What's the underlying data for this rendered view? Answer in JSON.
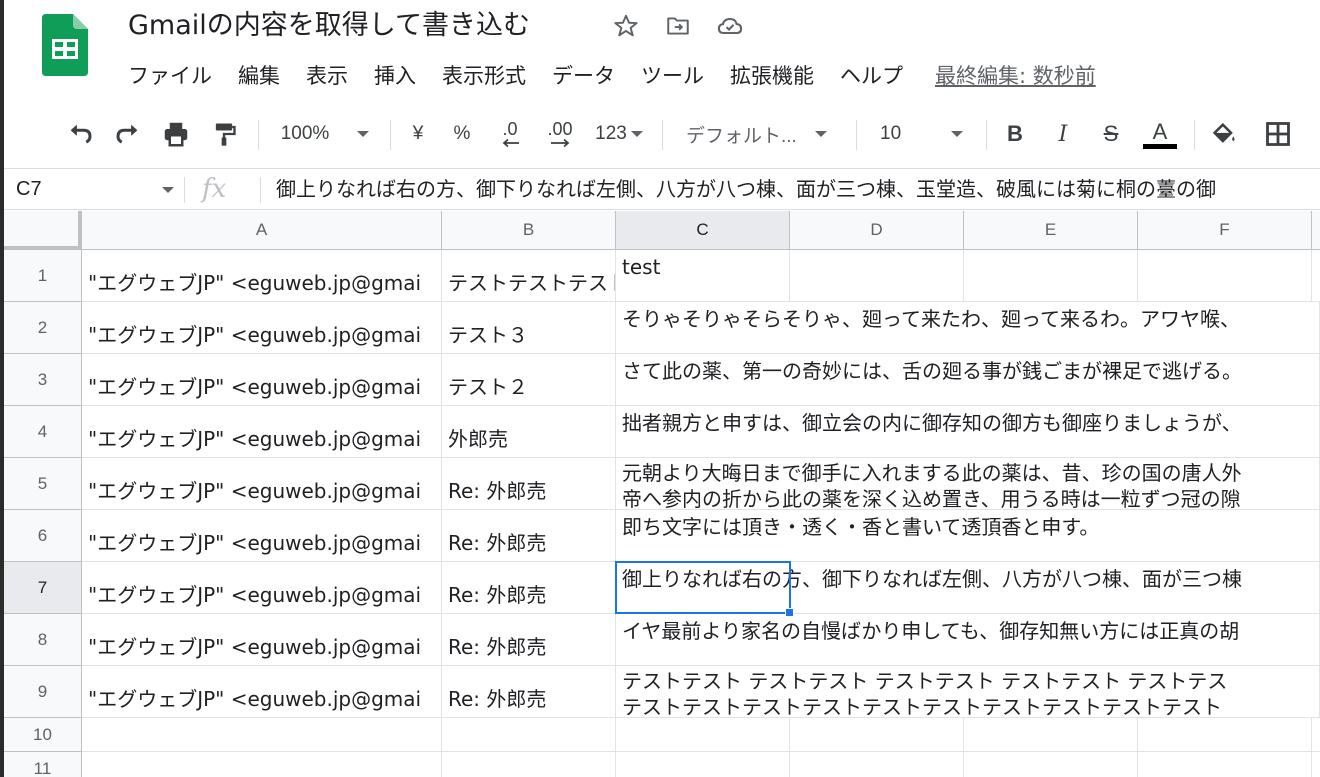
{
  "app": {
    "doc_title": "Gmailの内容を取得して書き込む",
    "icons": [
      "sheets-logo-icon",
      "star-icon",
      "move-to-folder-icon",
      "cloud-status-icon"
    ]
  },
  "menu": {
    "items": [
      "ファイル",
      "編集",
      "表示",
      "挿入",
      "表示形式",
      "データ",
      "ツール",
      "拡張機能",
      "ヘルプ"
    ],
    "last_edit": "最終編集: 数秒前"
  },
  "toolbar": {
    "zoom": "100%",
    "currency": "¥",
    "percent": "%",
    "decimal_decrease": ".0",
    "decimal_increase": ".00",
    "number_format": "123",
    "font": "デフォルト...",
    "font_size": "10",
    "bold": "B",
    "italic": "I",
    "strike": "S",
    "text_color": "A",
    "text_color_bar": "#000000"
  },
  "formula_bar": {
    "cell_ref": "C7",
    "fx": "fx",
    "content": "御上りなれば右の方、御下りなれば左側、八方が八つ棟、面が三つ棟、玉堂造、破風には菊に桐の薹の御"
  },
  "grid": {
    "columns": [
      "A",
      "B",
      "C",
      "D",
      "E",
      "F"
    ],
    "active_column": "C",
    "active_row": "7",
    "rows": [
      {
        "num": "1",
        "a": "\"エグウェブJP\" <eguweb.jp@gmai",
        "b": "テストテストテスト",
        "c": "test"
      },
      {
        "num": "2",
        "a": "\"エグウェブJP\" <eguweb.jp@gmai",
        "b": "テスト３",
        "c": "そりゃそりゃそらそりゃ、廻って来たわ、廻って来るわ。アワヤ喉、"
      },
      {
        "num": "3",
        "a": "\"エグウェブJP\" <eguweb.jp@gmai",
        "b": "テスト２",
        "c": "さて此の薬、第一の奇妙には、舌の廻る事が銭ごまが裸足で逃げる。"
      },
      {
        "num": "4",
        "a": "\"エグウェブJP\" <eguweb.jp@gmai",
        "b": "外郎売",
        "c": "拙者親方と申すは、御立会の内に御存知の御方も御座りましょうが、"
      },
      {
        "num": "5",
        "a": "\"エグウェブJP\" <eguweb.jp@gmai",
        "b": "Re: 外郎売",
        "c": "元朝より大晦日まで御手に入れまする此の薬は、昔、珍の国の唐人外",
        "c2": "帝へ参内の折から此の薬を深く込め置き、用うる時は一粒ずつ冠の隙"
      },
      {
        "num": "6",
        "a": "\"エグウェブJP\" <eguweb.jp@gmai",
        "b": "Re: 外郎売",
        "c": "即ち文字には頂き・透く・香と書いて透頂香と申す。"
      },
      {
        "num": "7",
        "a": "\"エグウェブJP\" <eguweb.jp@gmai",
        "b": "Re: 外郎売",
        "c": "御上りなれば右の方、御下りなれば左側、八方が八つ棟、面が三つ棟"
      },
      {
        "num": "8",
        "a": "\"エグウェブJP\" <eguweb.jp@gmai",
        "b": "Re: 外郎売",
        "c": "イヤ最前より家名の自慢ばかり申しても、御存知無い方には正真の胡"
      },
      {
        "num": "9",
        "a": "\"エグウェブJP\" <eguweb.jp@gmai",
        "b": "Re: 外郎売",
        "c": "テストテスト テストテスト テストテスト テストテスト テストテス",
        "c2": "テストテストテストテストテストテストテストテストテストテスト"
      },
      {
        "num": "10",
        "a": "",
        "b": "",
        "c": ""
      },
      {
        "num": "11",
        "a": "",
        "b": "",
        "c": ""
      }
    ]
  },
  "colors": {
    "logo_green": "#0f9d58",
    "selection_blue": "#1a73e8"
  }
}
